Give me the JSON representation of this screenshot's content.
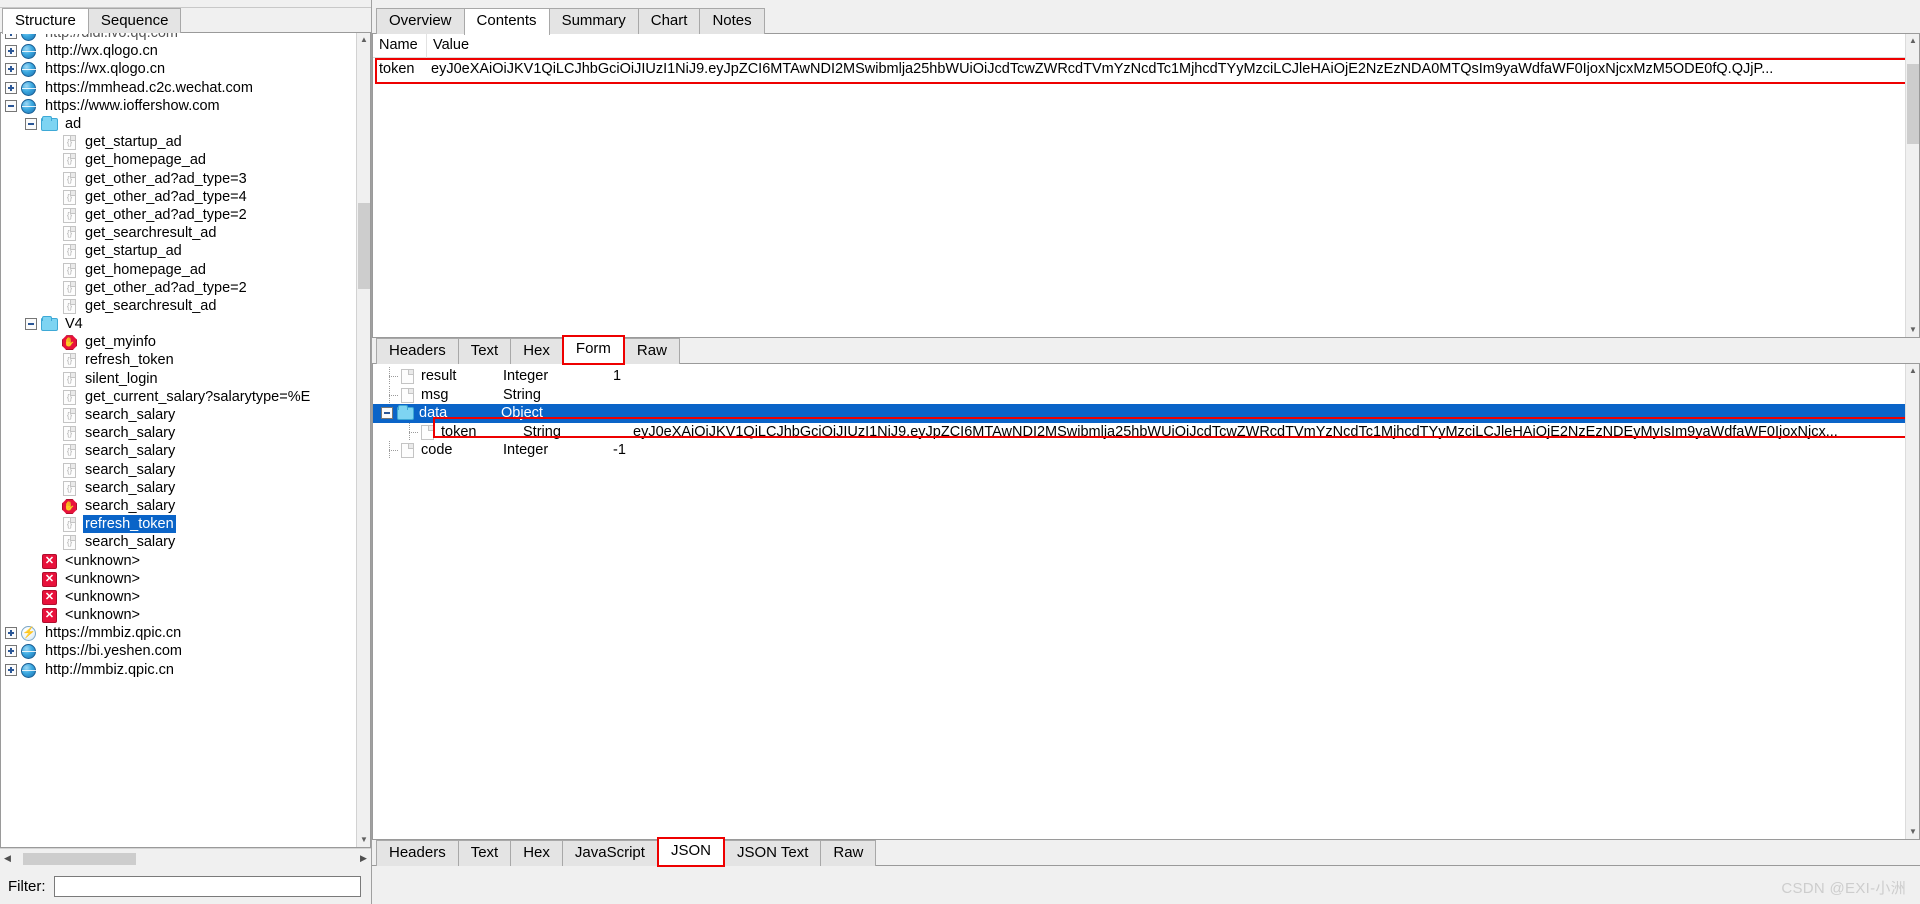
{
  "left_panel": {
    "tabs": [
      {
        "label": "Structure",
        "active": true
      },
      {
        "label": "Sequence",
        "active": false
      }
    ],
    "tree": [
      {
        "depth": 0,
        "toggle": "plus",
        "icon": "globe-icon",
        "label": "http://didi.ivo.qq.com",
        "selected": false,
        "clipped": true
      },
      {
        "depth": 0,
        "toggle": "plus",
        "icon": "globe-icon",
        "label": "http://wx.qlogo.cn",
        "selected": false
      },
      {
        "depth": 0,
        "toggle": "plus",
        "icon": "globe-icon",
        "label": "https://wx.qlogo.cn",
        "selected": false
      },
      {
        "depth": 0,
        "toggle": "plus",
        "icon": "globe-icon",
        "label": "https://mmhead.c2c.wechat.com",
        "selected": false
      },
      {
        "depth": 0,
        "toggle": "minus",
        "icon": "globe-icon",
        "label": "https://www.ioffershow.com",
        "selected": false
      },
      {
        "depth": 1,
        "toggle": "minus",
        "icon": "folder-icon",
        "label": "ad",
        "selected": false
      },
      {
        "depth": 2,
        "toggle": "none",
        "icon": "json-doc-icon",
        "label": "get_startup_ad",
        "selected": false
      },
      {
        "depth": 2,
        "toggle": "none",
        "icon": "json-doc-icon",
        "label": "get_homepage_ad",
        "selected": false
      },
      {
        "depth": 2,
        "toggle": "none",
        "icon": "json-doc-icon",
        "label": "get_other_ad?ad_type=3",
        "selected": false
      },
      {
        "depth": 2,
        "toggle": "none",
        "icon": "json-doc-icon",
        "label": "get_other_ad?ad_type=4",
        "selected": false
      },
      {
        "depth": 2,
        "toggle": "none",
        "icon": "json-doc-icon",
        "label": "get_other_ad?ad_type=2",
        "selected": false
      },
      {
        "depth": 2,
        "toggle": "none",
        "icon": "json-doc-icon",
        "label": "get_searchresult_ad",
        "selected": false
      },
      {
        "depth": 2,
        "toggle": "none",
        "icon": "json-doc-icon",
        "label": "get_startup_ad",
        "selected": false
      },
      {
        "depth": 2,
        "toggle": "none",
        "icon": "json-doc-icon",
        "label": "get_homepage_ad",
        "selected": false
      },
      {
        "depth": 2,
        "toggle": "none",
        "icon": "json-doc-icon",
        "label": "get_other_ad?ad_type=2",
        "selected": false
      },
      {
        "depth": 2,
        "toggle": "none",
        "icon": "json-doc-icon",
        "label": "get_searchresult_ad",
        "selected": false
      },
      {
        "depth": 1,
        "toggle": "minus",
        "icon": "folder-icon",
        "label": "V4",
        "selected": false
      },
      {
        "depth": 2,
        "toggle": "none",
        "icon": "blocked-icon",
        "label": "get_myinfo",
        "selected": false
      },
      {
        "depth": 2,
        "toggle": "none",
        "icon": "json-doc-icon",
        "label": "refresh_token",
        "selected": false
      },
      {
        "depth": 2,
        "toggle": "none",
        "icon": "json-doc-icon",
        "label": "silent_login",
        "selected": false
      },
      {
        "depth": 2,
        "toggle": "none",
        "icon": "json-doc-icon",
        "label": "get_current_salary?salarytype=%E",
        "selected": false
      },
      {
        "depth": 2,
        "toggle": "none",
        "icon": "json-doc-icon",
        "label": "search_salary",
        "selected": false
      },
      {
        "depth": 2,
        "toggle": "none",
        "icon": "json-doc-icon",
        "label": "search_salary",
        "selected": false
      },
      {
        "depth": 2,
        "toggle": "none",
        "icon": "json-doc-icon",
        "label": "search_salary",
        "selected": false
      },
      {
        "depth": 2,
        "toggle": "none",
        "icon": "json-doc-icon",
        "label": "search_salary",
        "selected": false
      },
      {
        "depth": 2,
        "toggle": "none",
        "icon": "json-doc-icon",
        "label": "search_salary",
        "selected": false
      },
      {
        "depth": 2,
        "toggle": "none",
        "icon": "blocked-icon",
        "label": "search_salary",
        "selected": false
      },
      {
        "depth": 2,
        "toggle": "none",
        "icon": "json-doc-icon",
        "label": "refresh_token",
        "selected": true
      },
      {
        "depth": 2,
        "toggle": "none",
        "icon": "json-doc-icon",
        "label": "search_salary",
        "selected": false
      },
      {
        "depth": 1,
        "toggle": "none",
        "icon": "error-icon",
        "label": "<unknown>",
        "selected": false
      },
      {
        "depth": 1,
        "toggle": "none",
        "icon": "error-icon",
        "label": "<unknown>",
        "selected": false
      },
      {
        "depth": 1,
        "toggle": "none",
        "icon": "error-icon",
        "label": "<unknown>",
        "selected": false
      },
      {
        "depth": 1,
        "toggle": "none",
        "icon": "error-icon",
        "label": "<unknown>",
        "selected": false
      },
      {
        "depth": 0,
        "toggle": "plus",
        "icon": "globe-bolt-icon",
        "label": "https://mmbiz.qpic.cn",
        "selected": false
      },
      {
        "depth": 0,
        "toggle": "plus",
        "icon": "globe-icon",
        "label": "https://bi.yeshen.com",
        "selected": false
      },
      {
        "depth": 0,
        "toggle": "plus",
        "icon": "globe-icon",
        "label": "http://mmbiz.qpic.cn",
        "selected": false
      }
    ],
    "filter": {
      "label": "Filter:",
      "value": "",
      "placeholder": ""
    }
  },
  "right_panel": {
    "main_tabs": [
      {
        "label": "Overview",
        "active": false
      },
      {
        "label": "Contents",
        "active": true
      },
      {
        "label": "Summary",
        "active": false
      },
      {
        "label": "Chart",
        "active": false
      },
      {
        "label": "Notes",
        "active": false
      }
    ],
    "request": {
      "columns": {
        "name": "Name",
        "value": "Value"
      },
      "rows": [
        {
          "name": "token",
          "value": "eyJ0eXAiOiJKV1QiLCJhbGciOiJIUzI1NiJ9.eyJpZCI6MTAwNDI2MSwibmlja25hbWUiOiJcdTcwZWRcdTVmYzNcdTc1MjhcdTYyMzciLCJleHAiOjE2NzEzNDA0MTQsIm9yaWdfaWF0IjoxNjcxMzM5ODE0fQ.QJjP..."
        }
      ],
      "highlighted": true
    },
    "request_tabs": [
      {
        "label": "Headers",
        "active": false
      },
      {
        "label": "Text",
        "active": false
      },
      {
        "label": "Hex",
        "active": false
      },
      {
        "label": "Form",
        "active": true,
        "redmark": true
      },
      {
        "label": "Raw",
        "active": false
      }
    ],
    "response_tree": [
      {
        "depth": 1,
        "icon": "doc-icon",
        "name": "result",
        "type": "Integer",
        "value": "1",
        "selected": false,
        "redmark": false
      },
      {
        "depth": 1,
        "icon": "doc-icon",
        "name": "msg",
        "type": "String",
        "value": "",
        "selected": false,
        "redmark": false
      },
      {
        "depth": 1,
        "icon": "folder-icon",
        "name": "data",
        "type": "Object",
        "value": "",
        "selected": true,
        "redmark": false
      },
      {
        "depth": 2,
        "icon": "doc-icon",
        "name": "token",
        "type": "String",
        "value": "eyJ0eXAiOiJKV1QiLCJhbGciOiJIUzI1NiJ9.eyJpZCI6MTAwNDI2MSwibmlja25hbWUiOiJcdTcwZWRcdTVmYzNcdTc1MjhcdTYyMzciLCJleHAiOjE2NzEzNDEyMyIsIm9yaWdfaWF0IjoxNjcx...",
        "selected": false,
        "redmark": true
      },
      {
        "depth": 1,
        "icon": "doc-icon",
        "name": "code",
        "type": "Integer",
        "value": "-1",
        "selected": false,
        "redmark": false
      }
    ],
    "response_tabs": [
      {
        "label": "Headers",
        "active": false
      },
      {
        "label": "Text",
        "active": false
      },
      {
        "label": "Hex",
        "active": false
      },
      {
        "label": "JavaScript",
        "active": false
      },
      {
        "label": "JSON",
        "active": true,
        "redmark": true
      },
      {
        "label": "JSON Text",
        "active": false
      },
      {
        "label": "Raw",
        "active": false
      }
    ],
    "watermark": "CSDN @EXI-小洲"
  },
  "colors": {
    "selection_blue": "#0a64c8",
    "highlight_red": "#ee0000",
    "panel_gray": "#f0f0f0",
    "watermark_gray": "#cdcdcd"
  }
}
